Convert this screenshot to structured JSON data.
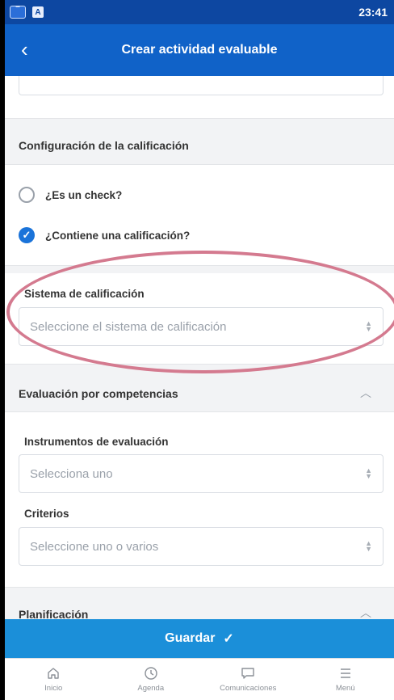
{
  "status_bar": {
    "time": "23:41",
    "icons": [
      "app-icon",
      "a-icon"
    ]
  },
  "app_bar": {
    "title": "Crear actividad evaluable",
    "back_icon": "chevron-left-icon"
  },
  "grading": {
    "section_title": "Configuración de la calificación",
    "options": [
      {
        "label": "¿Es un check?",
        "checked": false
      },
      {
        "label": "¿Contiene una calificación?",
        "checked": true
      }
    ],
    "system_label": "Sistema de calificación",
    "system_placeholder": "Seleccione el sistema de calificación"
  },
  "competencies": {
    "section_title": "Evaluación por competencias",
    "instruments_label": "Instrumentos de evaluación",
    "instruments_placeholder": "Selecciona uno",
    "criteria_label": "Criterios",
    "criteria_placeholder": "Seleccione uno o varios"
  },
  "planning": {
    "section_title": "Planificación"
  },
  "actions": {
    "save_label": "Guardar",
    "save_icon": "check-icon"
  },
  "tab_bar": {
    "items": [
      {
        "label": "Inicio",
        "icon": "home-icon"
      },
      {
        "label": "Agenda",
        "icon": "clock-icon"
      },
      {
        "label": "Comunicaciones",
        "icon": "chat-icon"
      },
      {
        "label": "Menú",
        "icon": "menu-icon"
      }
    ]
  },
  "colors": {
    "status_bar": "#0d47a1",
    "app_bar": "#1062c8",
    "save": "#1b8fd9",
    "accent": "#1a73d9",
    "annotation": "#d47a8f"
  }
}
